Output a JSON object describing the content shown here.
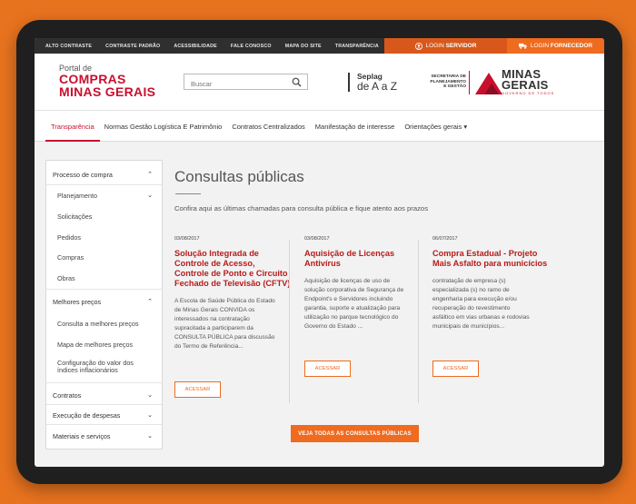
{
  "topbar": {
    "links": [
      "ALTO CONTRASTE",
      "CONTRASTE PADRÃO",
      "ACESSIBILIDADE",
      "FALE CONOSCO",
      "MAPA DO SITE",
      "TRANSPARÊNCIA"
    ],
    "login_servidor_prefix": "LOGIN",
    "login_servidor_bold": "SERVIDOR",
    "login_fornecedor_prefix": "LOGIN",
    "login_fornecedor_bold": "FORNECEDOR"
  },
  "header": {
    "portal_small": "Portal de",
    "portal_line1": "COMPRAS",
    "portal_line2": "MINAS GERAIS",
    "search_placeholder": "Buscar",
    "seplag_line1": "Seplag",
    "seplag_line2": "de A a Z",
    "secretaria_line1": "SECRETARIA DE",
    "secretaria_line2": "PLANEJAMENTO",
    "secretaria_line3": "E GESTÃO",
    "mg_line1": "MINAS",
    "mg_line2": "GERAIS",
    "mg_tagline": "GOVERNO DE TODOS",
    "brand_red": "#c8102e"
  },
  "nav": {
    "items": [
      "Transparência",
      "Normas Gestão Logística E Patrimônio",
      "Contratos Centralizados",
      "Manifestação de interesse",
      "Orientações gerais"
    ],
    "active": "Transparência"
  },
  "sidebar": {
    "processo": "Processo de compra",
    "processo_items": [
      "Planejamento",
      "Solicitações",
      "Pedidos",
      "Compras",
      "Obras"
    ],
    "melhores": "Melhores preços",
    "melhores_items": [
      "Consulta a melhores preços",
      "Mapa de melhores preços",
      "Configuração do valor dos",
      "índices inflacionários"
    ],
    "contratos": "Contratos",
    "execucao": "Execução de despesas",
    "materiais": "Materiais e serviços"
  },
  "main": {
    "title": "Consultas públicas",
    "intro": "Confira aqui as últimas chamadas para consulta pública e fique atento aos prazos",
    "cards": [
      {
        "date": "03/08/2017",
        "title_lines": [
          "Solução Integrada de",
          "Controle de Acesso,",
          "Controle de Ponto e Circuito",
          "Fechado de Televisão (CFTV)"
        ],
        "text_lines": [
          "A Escola de Saúde Pública do Estado",
          "de Minas Gerais CONVIDA os",
          "interessados na contratação",
          "supracitada a participarem da",
          "CONSULTA PÚBLICA para discussão",
          "do Termo de Referência..."
        ],
        "button": "ACESSAR"
      },
      {
        "date": "03/08/2017",
        "title_lines": [
          "Aquisição de Licenças",
          "Antivírus"
        ],
        "text_lines": [
          "Aquisição de licenças de uso de",
          "solução corporativa de Segurança de",
          "Endpoint's e Servidores incluindo",
          "garantia, suporte e atualização para",
          "utilização no parque tecnológico do",
          "Governo do Estado ..."
        ],
        "button": "ACESSAR"
      },
      {
        "date": "06/07/2017",
        "title_lines": [
          "Compra Estadual - Projeto",
          "Mais Asfalto para municícios"
        ],
        "text_lines": [
          "contratação de empresa (s)",
          "especializada (s) no ramo de",
          "engenharia para execução e/ou",
          "recuperação do revestimento",
          "asfáltico em vias urbanas e rodovias",
          "municipais de municípios..."
        ],
        "button": "ACESSAR"
      }
    ],
    "ver_todas": "VEJA TODAS AS CONSULTAS PÚBLICAS",
    "accent": "#ef6b1f"
  }
}
